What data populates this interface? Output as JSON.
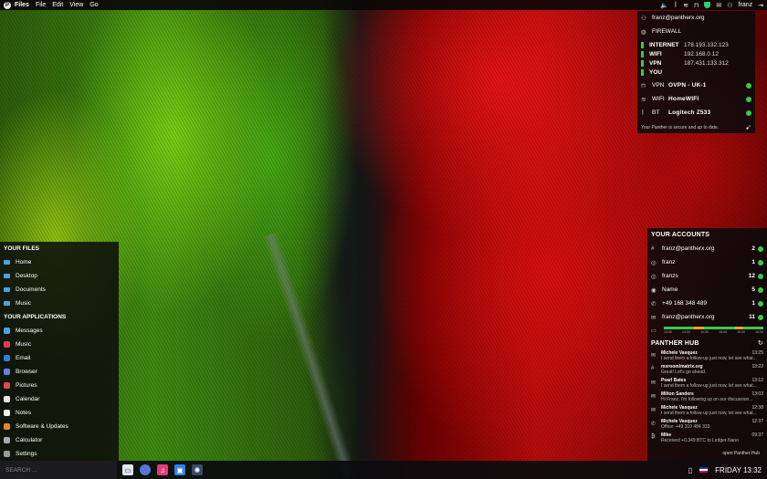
{
  "topbar": {
    "app": "Files",
    "menus": [
      "File",
      "Edit",
      "View",
      "Go"
    ],
    "user": "franz"
  },
  "security": {
    "host": "franz@pantherx.org",
    "firewall_label": "FIREWALL",
    "network": [
      {
        "label": "INTERNET",
        "value": "178.193.132.123"
      },
      {
        "label": "WIFI",
        "value": "192.168.0.12"
      },
      {
        "label": "VPN",
        "value": "187.431.133.312"
      },
      {
        "label": "YOU",
        "value": ""
      }
    ],
    "services": [
      {
        "key": "VPN",
        "value": "OVPN - UK-1"
      },
      {
        "key": "WIFI",
        "value": "HomeWIFI"
      },
      {
        "key": "BT",
        "value": "Logitech Z533"
      }
    ],
    "status": "Your Panther is secure and up to date."
  },
  "files": {
    "heading": "YOUR FILES",
    "items": [
      "Home",
      "Desktop",
      "Documents",
      "Music"
    ]
  },
  "applications": {
    "heading": "YOUR APPLICATIONS",
    "items": [
      {
        "label": "Messages",
        "color": "#4aa3e6"
      },
      {
        "label": "Music",
        "color": "#e23a5a"
      },
      {
        "label": "Email",
        "color": "#3a7be0"
      },
      {
        "label": "Browser",
        "color": "#6a7fe6"
      },
      {
        "label": "Pictures",
        "color": "#e24a4a"
      },
      {
        "label": "Calendar",
        "color": "#e8e8e8"
      },
      {
        "label": "Notes",
        "color": "#f0f0f0"
      },
      {
        "label": "Software & Updates",
        "color": "#e08a2a"
      },
      {
        "label": "Calculator",
        "color": "#aaaaaa"
      },
      {
        "label": "Settings",
        "color": "#999999"
      }
    ]
  },
  "accounts": {
    "heading": "YOUR ACCOUNTS",
    "items": [
      {
        "icon": "#",
        "label": "franz@pantherx.org",
        "count": "2"
      },
      {
        "icon": "◎",
        "label": "franz",
        "count": "1"
      },
      {
        "icon": "◎",
        "label": "franzs",
        "count": "12"
      },
      {
        "icon": "◉",
        "label": "Name",
        "count": "5"
      },
      {
        "icon": "✆",
        "label": "+49 168 348 489",
        "count": "1"
      },
      {
        "icon": "✉",
        "label": "franz@pantherx.org",
        "count": "11"
      }
    ],
    "timeline_ticks": [
      "13:30",
      "14:00",
      "14:30",
      "15:00",
      "15:30",
      "16:00"
    ]
  },
  "hub": {
    "heading": "PANTHER HUB",
    "messages": [
      {
        "icon": "✉",
        "name": "Michele Vasquez",
        "time": "13:25",
        "text": "I send them a follow-up just now, let see what..."
      },
      {
        "icon": "#",
        "name": "mxroom/matrix.org",
        "time": "13:22",
        "text": "Great! Let's go ahead."
      },
      {
        "icon": "✉",
        "name": "Pearl Bates",
        "time": "13:12",
        "text": "I send them a follow-up just now, let see what..."
      },
      {
        "icon": "✉",
        "name": "Milton Sanders",
        "time": "13:03",
        "text": "Hi Franz, I'm following up on our discussion..."
      },
      {
        "icon": "✉",
        "name": "Michele Vasquez",
        "time": "12:38",
        "text": "I send them a follow-up just now, let see what..."
      },
      {
        "icon": "✆",
        "name": "Michele Vasquez",
        "time": "12:37",
        "text": "Office: +49 310 484 333"
      },
      {
        "icon": "₿",
        "name": "Mike",
        "time": "09:37",
        "text": "Received +0.349 BTC to Ledger Nano"
      }
    ],
    "open_label": "open Panther Hub"
  },
  "bottom": {
    "search_placeholder": "SEARCH ...",
    "clock": "FRIDAY 13:32"
  },
  "colors": {
    "accent_green": "#3ac94a",
    "folder_blue": "#4aa3e6",
    "timeline_green": "#3ac94a",
    "timeline_orange": "#e8a030"
  }
}
